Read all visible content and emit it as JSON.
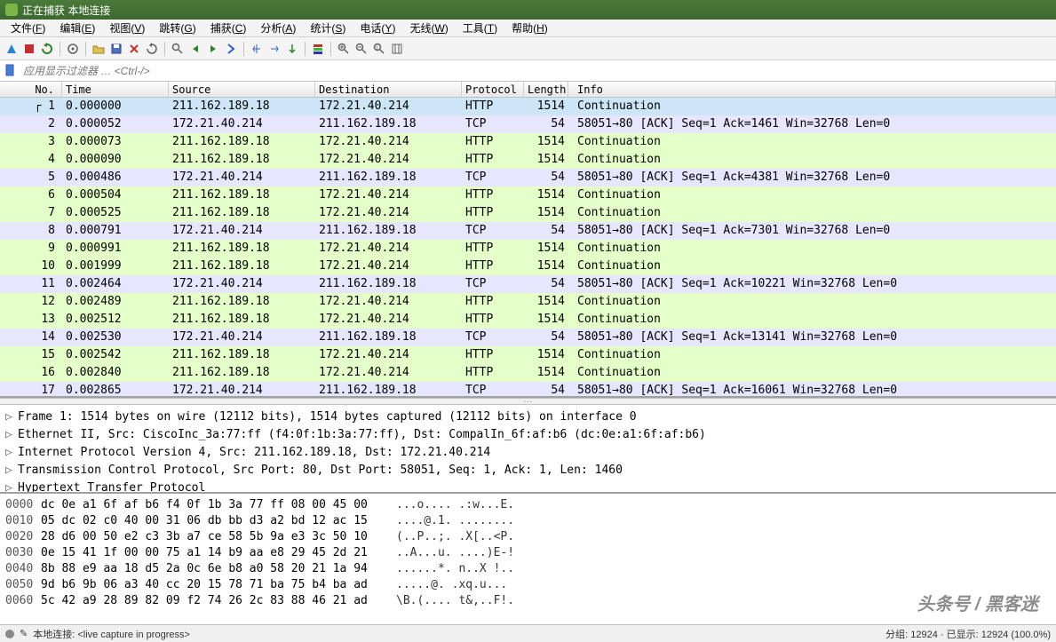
{
  "title": "正在捕获 本地连接",
  "menu": [
    "文件(F)",
    "编辑(E)",
    "视图(V)",
    "跳转(G)",
    "捕获(C)",
    "分析(A)",
    "统计(S)",
    "电话(Y)",
    "无线(W)",
    "工具(T)",
    "帮助(H)"
  ],
  "filter_placeholder": "应用显示过滤器 … <Ctrl-/>",
  "columns": {
    "no": "No.",
    "time": "Time",
    "source": "Source",
    "destination": "Destination",
    "protocol": "Protocol",
    "length": "Length",
    "info": "Info"
  },
  "packets": [
    {
      "no": 1,
      "time": "0.000000",
      "src": "211.162.189.18",
      "dst": "172.21.40.214",
      "proto": "HTTP",
      "len": 1514,
      "info": "Continuation",
      "sel": true
    },
    {
      "no": 2,
      "time": "0.000052",
      "src": "172.21.40.214",
      "dst": "211.162.189.18",
      "proto": "TCP",
      "len": 54,
      "info": "58051→80 [ACK] Seq=1 Ack=1461 Win=32768 Len=0"
    },
    {
      "no": 3,
      "time": "0.000073",
      "src": "211.162.189.18",
      "dst": "172.21.40.214",
      "proto": "HTTP",
      "len": 1514,
      "info": "Continuation"
    },
    {
      "no": 4,
      "time": "0.000090",
      "src": "211.162.189.18",
      "dst": "172.21.40.214",
      "proto": "HTTP",
      "len": 1514,
      "info": "Continuation"
    },
    {
      "no": 5,
      "time": "0.000486",
      "src": "172.21.40.214",
      "dst": "211.162.189.18",
      "proto": "TCP",
      "len": 54,
      "info": "58051→80 [ACK] Seq=1 Ack=4381 Win=32768 Len=0"
    },
    {
      "no": 6,
      "time": "0.000504",
      "src": "211.162.189.18",
      "dst": "172.21.40.214",
      "proto": "HTTP",
      "len": 1514,
      "info": "Continuation"
    },
    {
      "no": 7,
      "time": "0.000525",
      "src": "211.162.189.18",
      "dst": "172.21.40.214",
      "proto": "HTTP",
      "len": 1514,
      "info": "Continuation"
    },
    {
      "no": 8,
      "time": "0.000791",
      "src": "172.21.40.214",
      "dst": "211.162.189.18",
      "proto": "TCP",
      "len": 54,
      "info": "58051→80 [ACK] Seq=1 Ack=7301 Win=32768 Len=0"
    },
    {
      "no": 9,
      "time": "0.000991",
      "src": "211.162.189.18",
      "dst": "172.21.40.214",
      "proto": "HTTP",
      "len": 1514,
      "info": "Continuation"
    },
    {
      "no": 10,
      "time": "0.001999",
      "src": "211.162.189.18",
      "dst": "172.21.40.214",
      "proto": "HTTP",
      "len": 1514,
      "info": "Continuation"
    },
    {
      "no": 11,
      "time": "0.002464",
      "src": "172.21.40.214",
      "dst": "211.162.189.18",
      "proto": "TCP",
      "len": 54,
      "info": "58051→80 [ACK] Seq=1 Ack=10221 Win=32768 Len=0"
    },
    {
      "no": 12,
      "time": "0.002489",
      "src": "211.162.189.18",
      "dst": "172.21.40.214",
      "proto": "HTTP",
      "len": 1514,
      "info": "Continuation"
    },
    {
      "no": 13,
      "time": "0.002512",
      "src": "211.162.189.18",
      "dst": "172.21.40.214",
      "proto": "HTTP",
      "len": 1514,
      "info": "Continuation"
    },
    {
      "no": 14,
      "time": "0.002530",
      "src": "172.21.40.214",
      "dst": "211.162.189.18",
      "proto": "TCP",
      "len": 54,
      "info": "58051→80 [ACK] Seq=1 Ack=13141 Win=32768 Len=0"
    },
    {
      "no": 15,
      "time": "0.002542",
      "src": "211.162.189.18",
      "dst": "172.21.40.214",
      "proto": "HTTP",
      "len": 1514,
      "info": "Continuation"
    },
    {
      "no": 16,
      "time": "0.002840",
      "src": "211.162.189.18",
      "dst": "172.21.40.214",
      "proto": "HTTP",
      "len": 1514,
      "info": "Continuation"
    },
    {
      "no": 17,
      "time": "0.002865",
      "src": "172.21.40.214",
      "dst": "211.162.189.18",
      "proto": "TCP",
      "len": 54,
      "info": "58051→80 [ACK] Seq=1 Ack=16061 Win=32768 Len=0"
    }
  ],
  "details": [
    "Frame 1: 1514 bytes on wire (12112 bits), 1514 bytes captured (12112 bits) on interface 0",
    "Ethernet II, Src: CiscoInc_3a:77:ff (f4:0f:1b:3a:77:ff), Dst: CompalIn_6f:af:b6 (dc:0e:a1:6f:af:b6)",
    "Internet Protocol Version 4, Src: 211.162.189.18, Dst: 172.21.40.214",
    "Transmission Control Protocol, Src Port: 80, Dst Port: 58051, Seq: 1, Ack: 1, Len: 1460",
    "Hypertext Transfer Protocol"
  ],
  "hex": [
    {
      "off": "0000",
      "b": "dc 0e a1 6f af b6 f4 0f  1b 3a 77 ff 08 00 45 00",
      "a": "...o.... .:w...E."
    },
    {
      "off": "0010",
      "b": "05 dc 02 c0 40 00 31 06  db bb d3 a2 bd 12 ac 15",
      "a": "....@.1. ........"
    },
    {
      "off": "0020",
      "b": "28 d6 00 50 e2 c3 3b a7  ce 58 5b 9a e3 3c 50 10",
      "a": "(..P..;. .X[..<P."
    },
    {
      "off": "0030",
      "b": "0e 15 41 1f 00 00 75 a1  14 b9 aa e8 29 45 2d 21",
      "a": "..A...u. ....)E-!"
    },
    {
      "off": "0040",
      "b": "8b 88 e9 aa 18 d5 2a 0c  6e b8 a0 58 20 21 1a 94",
      "a": "......*. n..X !.."
    },
    {
      "off": "0050",
      "b": "9d b6 9b 06 a3 40 cc 20  15 78 71 ba 75 b4 ba ad",
      "a": ".....@.  .xq.u..."
    },
    {
      "off": "0060",
      "b": "5c 42 a9 28 89 82 09 f2  74 26 2c 83 88 46 21 ad",
      "a": "\\B.(.... t&,..F!."
    }
  ],
  "status": {
    "left": "本地连接: <live capture in progress>",
    "right": "分组: 12924 · 已显示: 12924 (100.0%)"
  },
  "watermark": "头条号 / 黑客迷"
}
